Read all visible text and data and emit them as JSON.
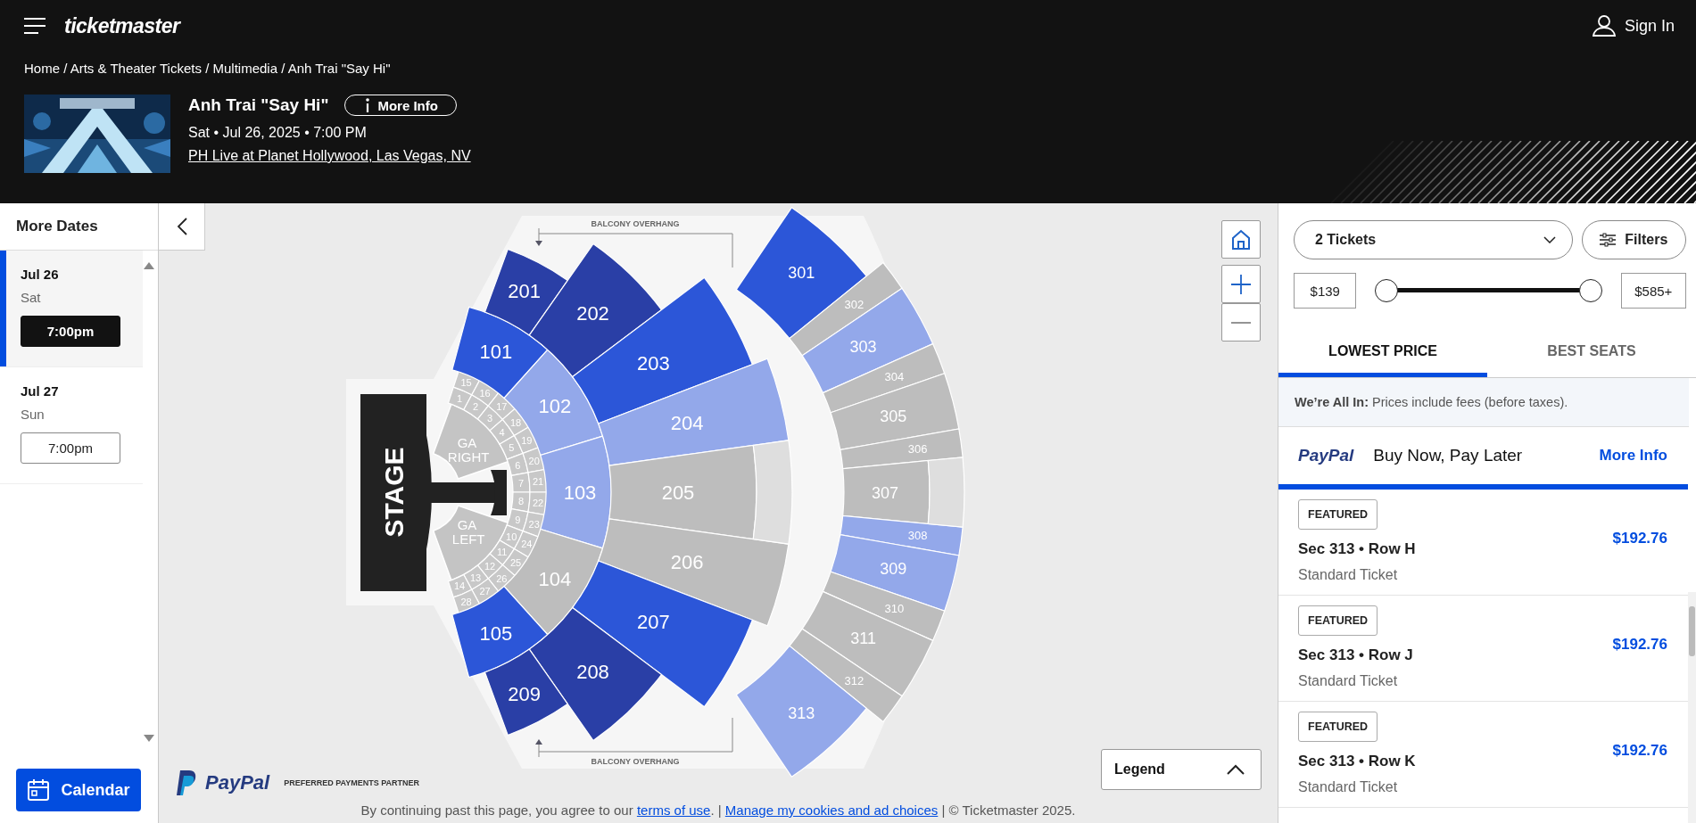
{
  "header": {
    "logo": "ticketmaster",
    "sign_in": "Sign In",
    "breadcrumb": "Home / Arts & Theater Tickets / Multimedia / Anh Trai \"Say Hi\""
  },
  "event": {
    "title": "Anh Trai \"Say Hi\"",
    "more_info": "More Info",
    "datetime": "Sat • Jul 26, 2025 • 7:00 PM",
    "venue": "PH Live at Planet Hollywood, Las Vegas, NV"
  },
  "sidebar": {
    "title": "More Dates",
    "dates": [
      {
        "date": "Jul 26",
        "day": "Sat",
        "time": "7:00pm",
        "selected": true
      },
      {
        "date": "Jul 27",
        "day": "Sun",
        "time": "7:00pm",
        "selected": false
      }
    ],
    "calendar": "Calendar"
  },
  "map": {
    "stage": "STAGE",
    "overhang_labels": [
      "BALCONY OVERHANG",
      "BALCONY OVERHANG"
    ],
    "ga_areas": [
      "GA RIGHT",
      "GA LEFT"
    ],
    "boxes": [
      "1",
      "2",
      "3",
      "4",
      "5",
      "6",
      "7",
      "8",
      "9",
      "10",
      "11",
      "12",
      "13",
      "14",
      "15",
      "16",
      "17",
      "18",
      "19",
      "20",
      "21",
      "22",
      "23",
      "24",
      "25",
      "26",
      "27",
      "28"
    ],
    "sections": [
      {
        "label": "101",
        "color": "#2c56d8"
      },
      {
        "label": "102",
        "color": "#93a8ea"
      },
      {
        "label": "103",
        "color": "#93a8ea"
      },
      {
        "label": "104",
        "color": "#bdbdbd"
      },
      {
        "label": "105",
        "color": "#2c56d8"
      },
      {
        "label": "201",
        "color": "#2a3fa6"
      },
      {
        "label": "202",
        "color": "#2a3fa6"
      },
      {
        "label": "203",
        "color": "#2c56d8"
      },
      {
        "label": "204",
        "color": "#93a8ea"
      },
      {
        "label": "205",
        "color": "#bdbdbd"
      },
      {
        "label": "206",
        "color": "#bdbdbd"
      },
      {
        "label": "207",
        "color": "#2c56d8"
      },
      {
        "label": "208",
        "color": "#2a3fa6"
      },
      {
        "label": "209",
        "color": "#2a3fa6"
      },
      {
        "label": "301",
        "color": "#2c56d8"
      },
      {
        "label": "302",
        "color": "#bdbdbd"
      },
      {
        "label": "303",
        "color": "#93a8ea"
      },
      {
        "label": "304",
        "color": "#bdbdbd"
      },
      {
        "label": "305",
        "color": "#bdbdbd"
      },
      {
        "label": "306",
        "color": "#bdbdbd"
      },
      {
        "label": "307",
        "color": "#bdbdbd"
      },
      {
        "label": "308",
        "color": "#93a8ea"
      },
      {
        "label": "309",
        "color": "#93a8ea"
      },
      {
        "label": "310",
        "color": "#bdbdbd"
      },
      {
        "label": "311",
        "color": "#bdbdbd"
      },
      {
        "label": "312",
        "color": "#bdbdbd"
      },
      {
        "label": "313",
        "color": "#93a8ea"
      }
    ],
    "legend": "Legend",
    "paypal_logo": "PayPal",
    "paypal_partner": "PREFERRED PAYMENTS PARTNER"
  },
  "footer": {
    "parts": [
      {
        "kind": "text",
        "text": "By continuing past this page, you agree to our "
      },
      {
        "kind": "link",
        "text": "terms of use"
      },
      {
        "kind": "text",
        "text": ". | "
      },
      {
        "kind": "link",
        "text": "Manage my cookies and ad choices"
      },
      {
        "kind": "text",
        "text": " | © Ticketmaster 2025."
      }
    ]
  },
  "panel": {
    "quantity": "2 Tickets",
    "filters": "Filters",
    "price_min": "$139",
    "price_max": "$585+",
    "thumbs": [
      {
        "level": 0
      },
      {
        "level": 1
      }
    ],
    "tabs": [
      {
        "label": "LOWEST PRICE",
        "selected": true
      },
      {
        "label": "BEST SEATS",
        "selected": false
      }
    ],
    "notice": "**We’re All In:** Prices include fees (before taxes).",
    "paypal": {
      "logo": "PayPal",
      "text": "Buy Now, Pay Later",
      "link": "More Info"
    },
    "listings": [
      {
        "badge": "FEATURED",
        "seat": "Sec 313 • Row H",
        "type": "Standard Ticket",
        "price": "$192.76"
      },
      {
        "badge": "FEATURED",
        "seat": "Sec 313 • Row J",
        "type": "Standard Ticket",
        "price": "$192.76"
      },
      {
        "badge": "FEATURED",
        "seat": "Sec 313 • Row K",
        "type": "Standard Ticket",
        "price": "$192.76"
      }
    ]
  }
}
